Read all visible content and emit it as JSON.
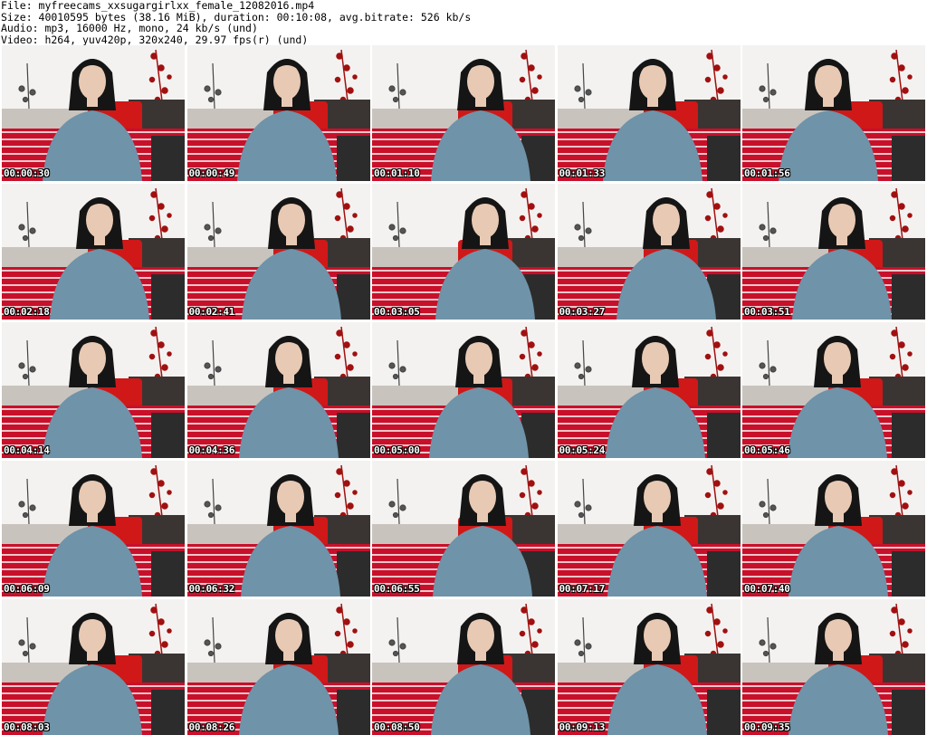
{
  "header": {
    "file_line": "File: myfreecams_xxsugargirlxx_female_12082016.mp4",
    "size_line": "Size: 40010595 bytes (38.16 MiB), duration: 00:10:08, avg.bitrate: 526 kb/s",
    "audio_line": "Audio: mp3, 16000 Hz, mono, 24 kb/s (und)",
    "video_line": "Video: h264, yuv420p, 320x240, 29.97 fps(r) (und)"
  },
  "thumbnails": [
    {
      "timestamp": "00:00:30"
    },
    {
      "timestamp": "00:00:49"
    },
    {
      "timestamp": "00:01:10"
    },
    {
      "timestamp": "00:01:33"
    },
    {
      "timestamp": "00:01:56"
    },
    {
      "timestamp": "00:02:18"
    },
    {
      "timestamp": "00:02:41"
    },
    {
      "timestamp": "00:03:05"
    },
    {
      "timestamp": "00:03:27"
    },
    {
      "timestamp": "00:03:51"
    },
    {
      "timestamp": "00:04:14"
    },
    {
      "timestamp": "00:04:36"
    },
    {
      "timestamp": "00:05:00"
    },
    {
      "timestamp": "00:05:24"
    },
    {
      "timestamp": "00:05:46"
    },
    {
      "timestamp": "00:06:09"
    },
    {
      "timestamp": "00:06:32"
    },
    {
      "timestamp": "00:06:55"
    },
    {
      "timestamp": "00:07:17"
    },
    {
      "timestamp": "00:07:40"
    },
    {
      "timestamp": "00:08:03"
    },
    {
      "timestamp": "00:08:26"
    },
    {
      "timestamp": "00:08:50"
    },
    {
      "timestamp": "00:09:13"
    },
    {
      "timestamp": "00:09:35"
    }
  ],
  "colors": {
    "wall": "#e9e6e3",
    "pillow": "#d01818",
    "blanket": "#c8102a",
    "sweater": "#6f93a8",
    "hair": "#151515",
    "skin": "#e8c9b4",
    "plant": "#a01010",
    "sofa": "#3a3532"
  }
}
